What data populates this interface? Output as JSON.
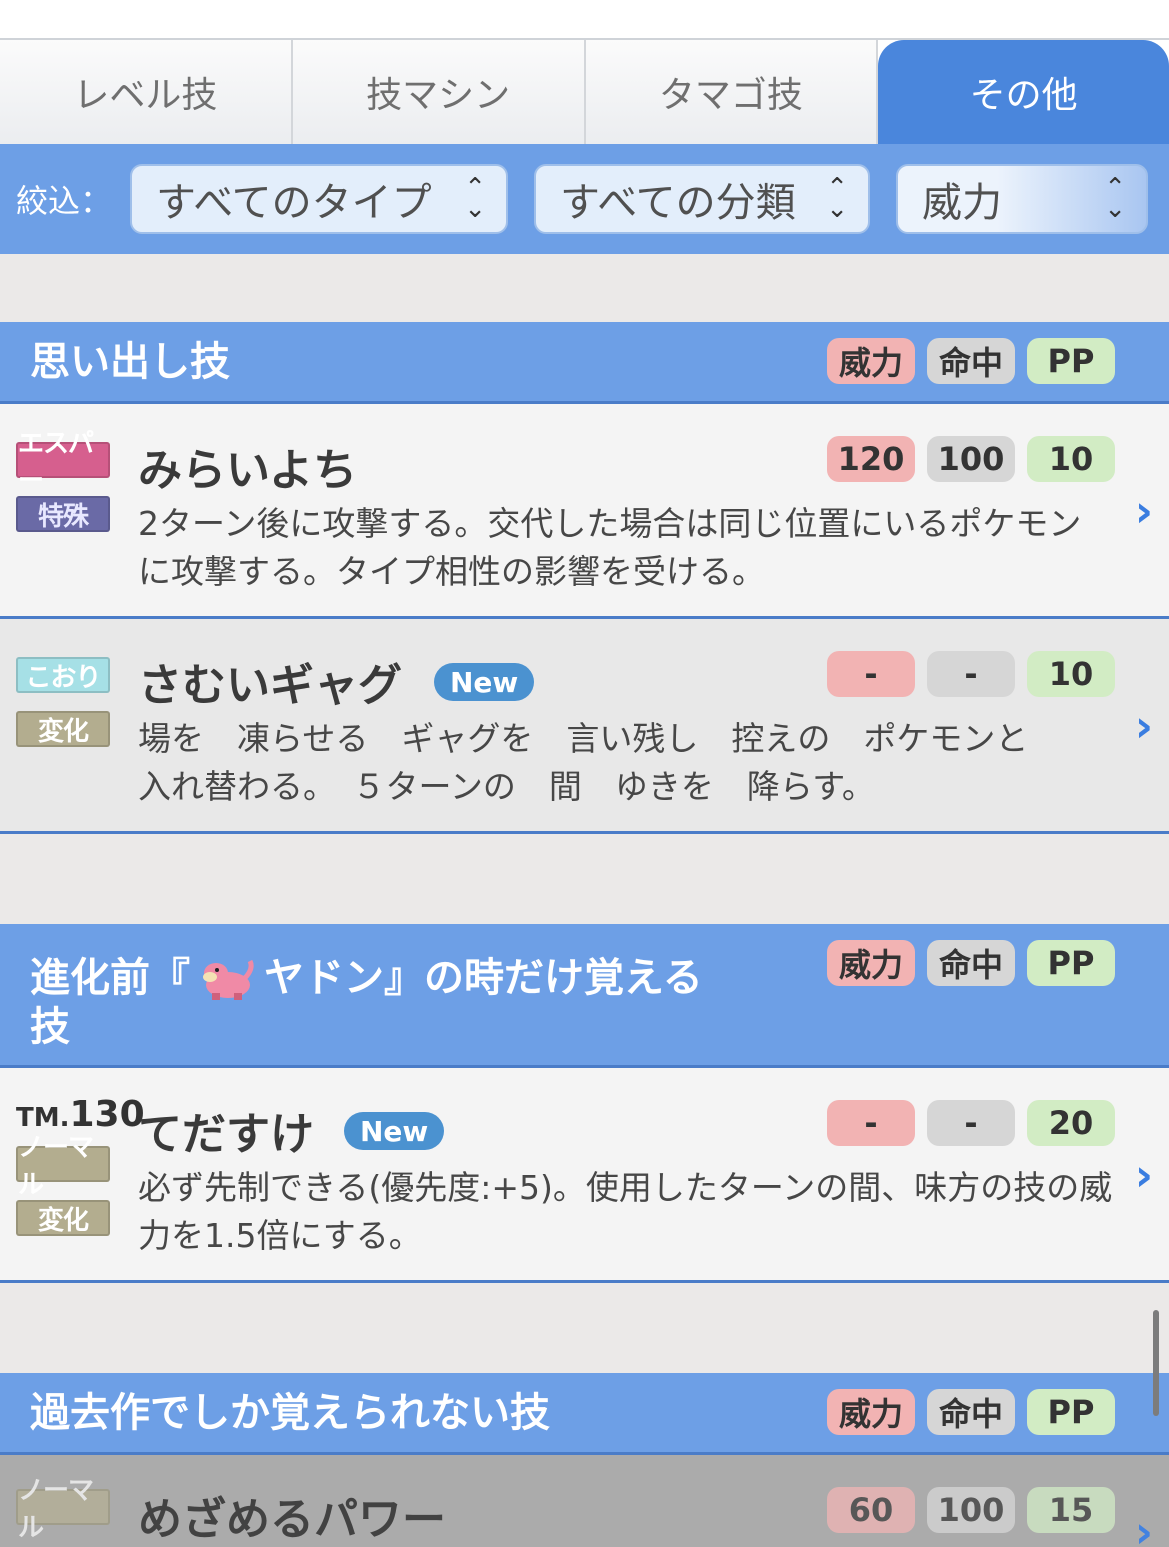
{
  "tabs": [
    {
      "label": "レベル技"
    },
    {
      "label": "技マシン"
    },
    {
      "label": "タマゴ技"
    },
    {
      "label": "その他"
    }
  ],
  "filter": {
    "label": "絞込：",
    "type_select": "すべてのタイプ",
    "category_select": "すべての分類",
    "sort_select": "威力"
  },
  "stat_headers": {
    "power": "威力",
    "accuracy": "命中",
    "pp": "PP"
  },
  "sections": [
    {
      "title": "思い出し技",
      "moves": [
        {
          "type": "エスパー",
          "category": "特殊",
          "name": "みらいよち",
          "power": "120",
          "accuracy": "100",
          "pp": "10",
          "description": "2ターン後に攻撃する。交代した場合は同じ位置にいるポケモンに攻撃する。タイプ相性の影響を受ける。"
        },
        {
          "type": "こおり",
          "category": "変化",
          "name": "さむいギャグ",
          "new": "New",
          "power": "-",
          "accuracy": "-",
          "pp": "10",
          "description": "場を　凍らせる　ギャグを　言い残し　控えの　ポケモンと　入れ替わる。　５ターンの　間　ゆきを　降らす。"
        }
      ]
    },
    {
      "title_prefix": "進化前『",
      "title_pokemon": "ヤドン",
      "title_suffix": "』の時だけ覚える技",
      "moves": [
        {
          "tm_prefix": "TM.",
          "tm_number": "130",
          "type": "ノーマル",
          "category": "変化",
          "name": "てだすけ",
          "new": "New",
          "power": "-",
          "accuracy": "-",
          "pp": "20",
          "description": "必ず先制できる(優先度:+5)。使用したターンの間、味方の技の威力を1.5倍にする。"
        }
      ]
    },
    {
      "title": "過去作でしか覚えられない技",
      "moves": [
        {
          "type": "ノーマル",
          "name": "めざめるパワー",
          "power": "60",
          "accuracy": "100",
          "pp": "15"
        }
      ]
    }
  ]
}
